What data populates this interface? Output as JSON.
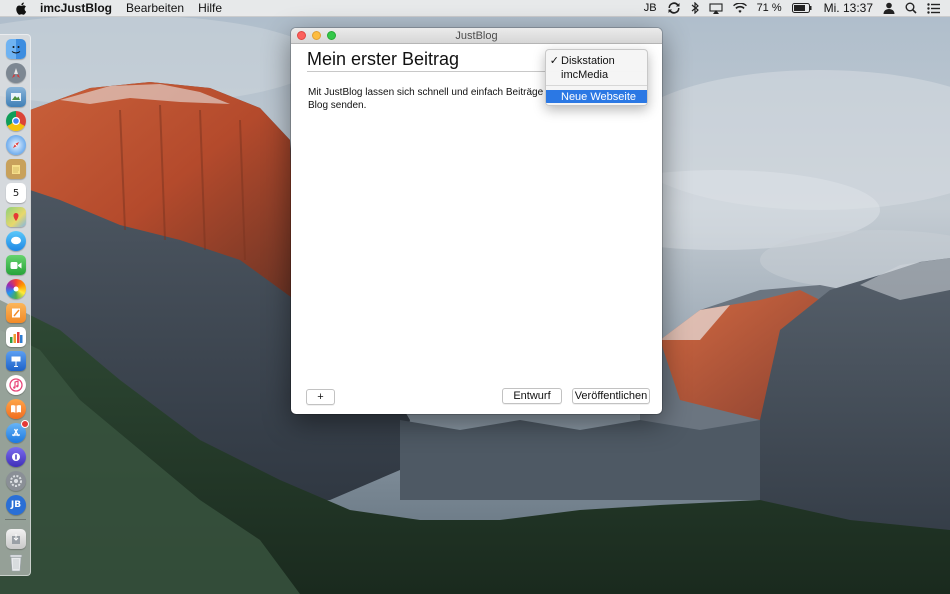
{
  "menubar": {
    "app_name": "imcJustBlog",
    "items": [
      {
        "label": "Bearbeiten"
      },
      {
        "label": "Hilfe"
      }
    ],
    "status": {
      "user_initials": "JB",
      "battery_percent": "71 %",
      "clock": "Mi. 13:37"
    }
  },
  "window": {
    "title": "JustBlog",
    "post_title": "Mein erster Beitrag",
    "post_body": "Mit JustBlog lassen sich schnell und einfach Beiträge\nBlog senden.",
    "buttons": {
      "add_label": "+",
      "draft_label": "Entwurf",
      "publish_label": "Veröffentlichen"
    }
  },
  "site_menu": {
    "items": [
      {
        "label": "Diskstation",
        "checked": true,
        "check_mark": "✓"
      },
      {
        "label": "imcMedia",
        "checked": false,
        "check_mark": ""
      },
      {
        "label": "Neue Webseite",
        "highlighted": true
      }
    ]
  },
  "dock": {
    "icons": [
      "finder-icon",
      "launchpad-icon",
      "preview-icon",
      "chrome-icon",
      "safari-icon",
      "notes-icon",
      "calendar-icon",
      "maps-icon",
      "messages-icon",
      "facetime-icon",
      "photos-icon",
      "pages-icon",
      "numbers-icon",
      "keynote-icon",
      "itunes-icon",
      "ibooks-icon",
      "app-store-icon",
      "onepassword-icon",
      "system-preferences-icon",
      "justblog-icon",
      "downloads-icon",
      "trash-icon"
    ],
    "calendar_day": "5",
    "justblog_badge": "JB"
  },
  "colors": {
    "accent": "#2b78e4",
    "close": "#fc605c",
    "minimize": "#fdbc40",
    "maximize": "#34c84a"
  }
}
